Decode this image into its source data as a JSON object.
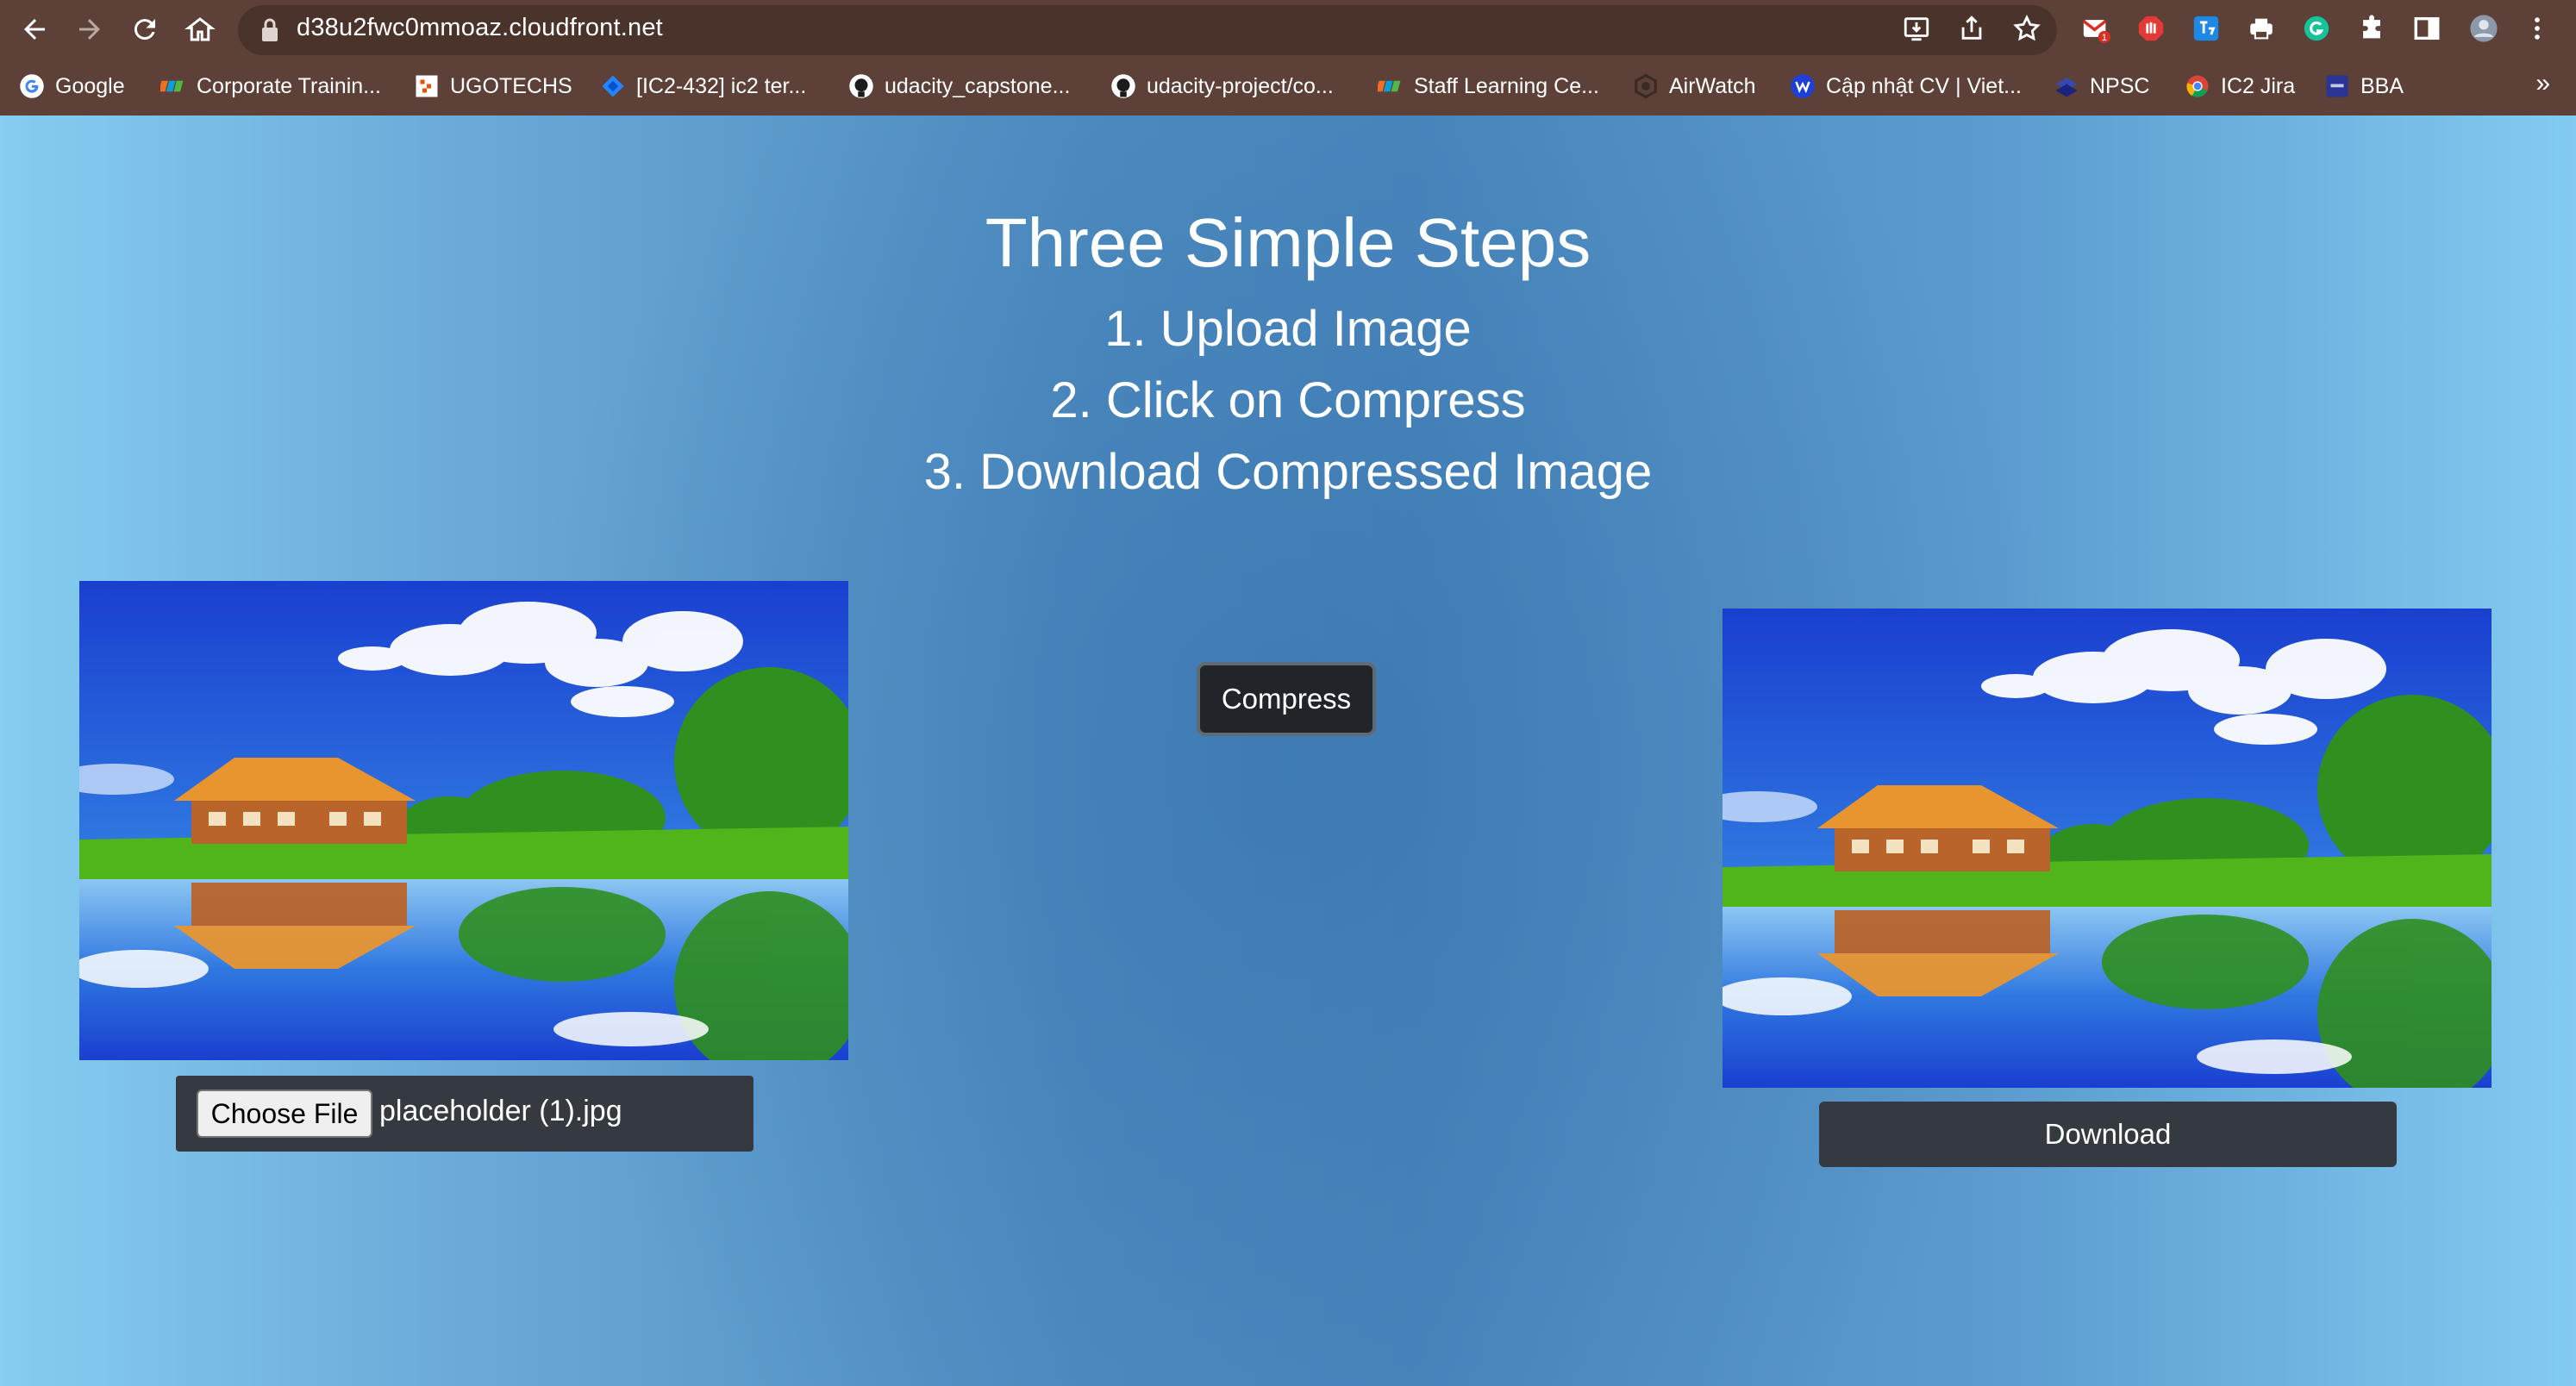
{
  "browser": {
    "url": "d38u2fwc0mmoaz.cloudfront.net",
    "extension_badge_count": "1",
    "bookmarks": [
      {
        "label": "Google",
        "icon": "google-icon"
      },
      {
        "label": "Corporate Trainin...",
        "icon": "fpt-icon"
      },
      {
        "label": "UGOTECHS",
        "icon": "ugotechs-icon"
      },
      {
        "label": "[IC2-432] ic2 ter...",
        "icon": "jira-icon"
      },
      {
        "label": "udacity_capstone...",
        "icon": "github-icon"
      },
      {
        "label": "udacity-project/co...",
        "icon": "github-icon"
      },
      {
        "label": "Staff Learning Ce...",
        "icon": "fpt-icon"
      },
      {
        "label": "AirWatch",
        "icon": "airwatch-icon"
      },
      {
        "label": "Cập nhật CV | Viet...",
        "icon": "vietnamworks-icon"
      },
      {
        "label": "NPSC",
        "icon": "npsc-icon"
      },
      {
        "label": "IC2 Jira",
        "icon": "chrome-icon"
      },
      {
        "label": "BBA",
        "icon": "bba-icon"
      }
    ],
    "more_bookmarks": "»"
  },
  "page": {
    "title": "Three Simple Steps",
    "steps": [
      "1. Upload Image",
      "2. Click on Compress",
      "3. Download Compressed Image"
    ],
    "upload": {
      "choose_label": "Choose File",
      "file_name": "placeholder (1).jpg"
    },
    "compress_label": "Compress",
    "download_label": "Download"
  },
  "colors": {
    "chrome_bg": "#5d4037",
    "button_dark": "#343a40",
    "page_gradient_edge": "#86cdf1",
    "page_gradient_center": "#4a87bd"
  }
}
